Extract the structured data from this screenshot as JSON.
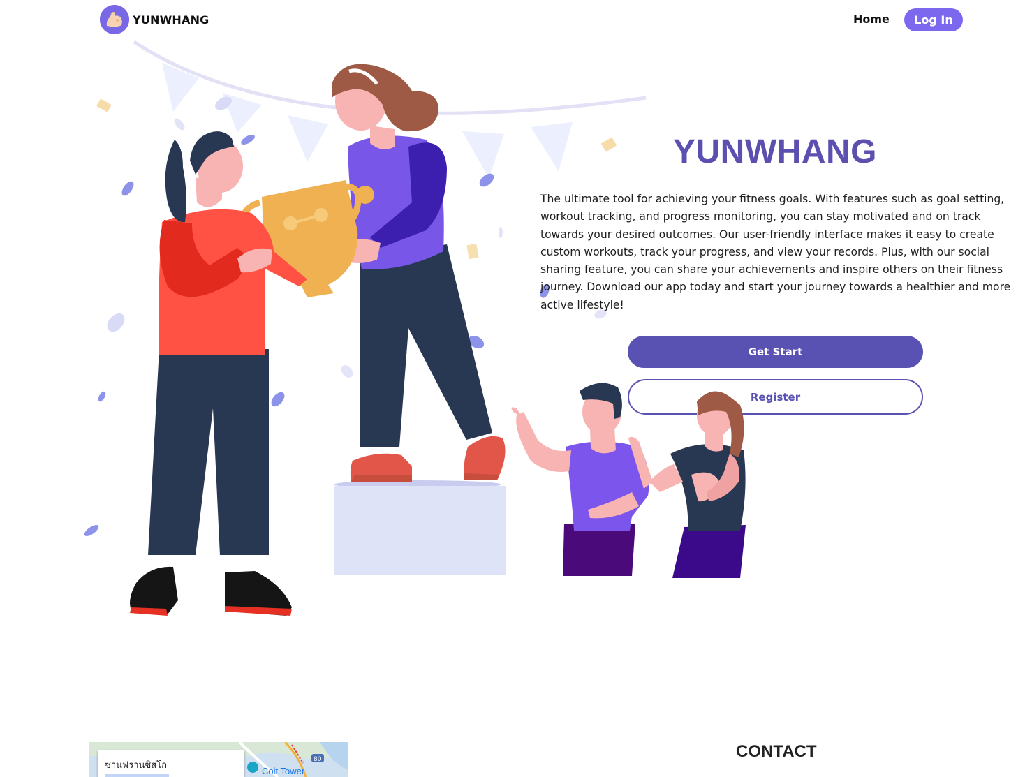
{
  "header": {
    "brand": "YUNWHANG",
    "nav_home": "Home",
    "nav_login": "Log In"
  },
  "hero": {
    "title": "YUNWHANG",
    "description": "The ultimate tool for achieving your fitness goals. With features such as goal setting, workout tracking, and progress monitoring, you can stay motivated and on track towards your desired outcomes. Our user-friendly interface makes it easy to create custom workouts, track your progress, and view your records. Plus, with our social sharing feature, you can share your achievements and inspire others on their fitness journey. Download our app today and start your journey towards a healthier and more active lifestyle!",
    "primary_button": "Get Start",
    "secondary_button": "Register"
  },
  "footer": {
    "map_place": "ซานฟรานซิสโก",
    "map_landmark": "Coit Tower",
    "contact_heading": "CONTACT"
  },
  "colors": {
    "brand_purple": "#5a52b3",
    "login_purple": "#7b68ee",
    "logo_badge": "#7868e6"
  },
  "icons": {
    "logo": "flexed-arm-icon",
    "map_pin": "map-pin-icon"
  }
}
